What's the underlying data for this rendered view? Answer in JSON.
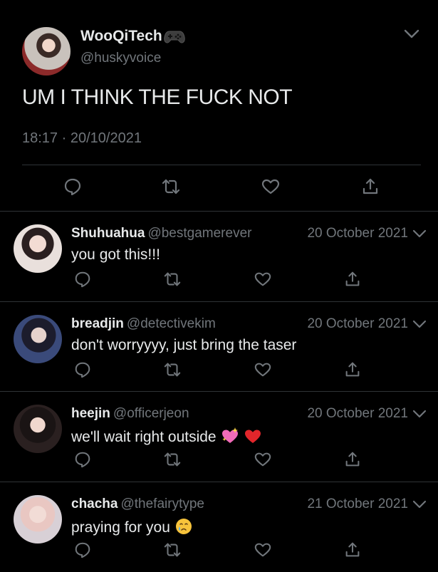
{
  "main_tweet": {
    "display_name": "WooQiTech",
    "name_emoji": "video-game-controller",
    "handle": "@huskyvoice",
    "text": "UM I THINK THE FUCK NOT",
    "time": "18:17",
    "date": "20/10/2021"
  },
  "replies": [
    {
      "display_name": "Shuhuahua",
      "handle": "@bestgamerever",
      "date": "20 October 2021",
      "text": "you got this!!!",
      "emojis": []
    },
    {
      "display_name": "breadjin",
      "handle": "@detectivekim",
      "date": "20 October 2021",
      "text": "don't worryyyy, just bring the taser",
      "emojis": []
    },
    {
      "display_name": "heejin",
      "handle": "@officerjeon",
      "date": "20 October 2021",
      "text": "we'll wait right outside",
      "emojis": [
        "sparkling-heart",
        "red-heart"
      ]
    },
    {
      "display_name": "chacha",
      "handle": "@thefairytype",
      "date": "21 October 2021",
      "text": "praying for you",
      "emojis": [
        "crying-face"
      ]
    }
  ],
  "theme": {
    "background": "#000000",
    "text": "#e7e9ea",
    "muted": "#71767b",
    "divider": "#2f3336"
  }
}
